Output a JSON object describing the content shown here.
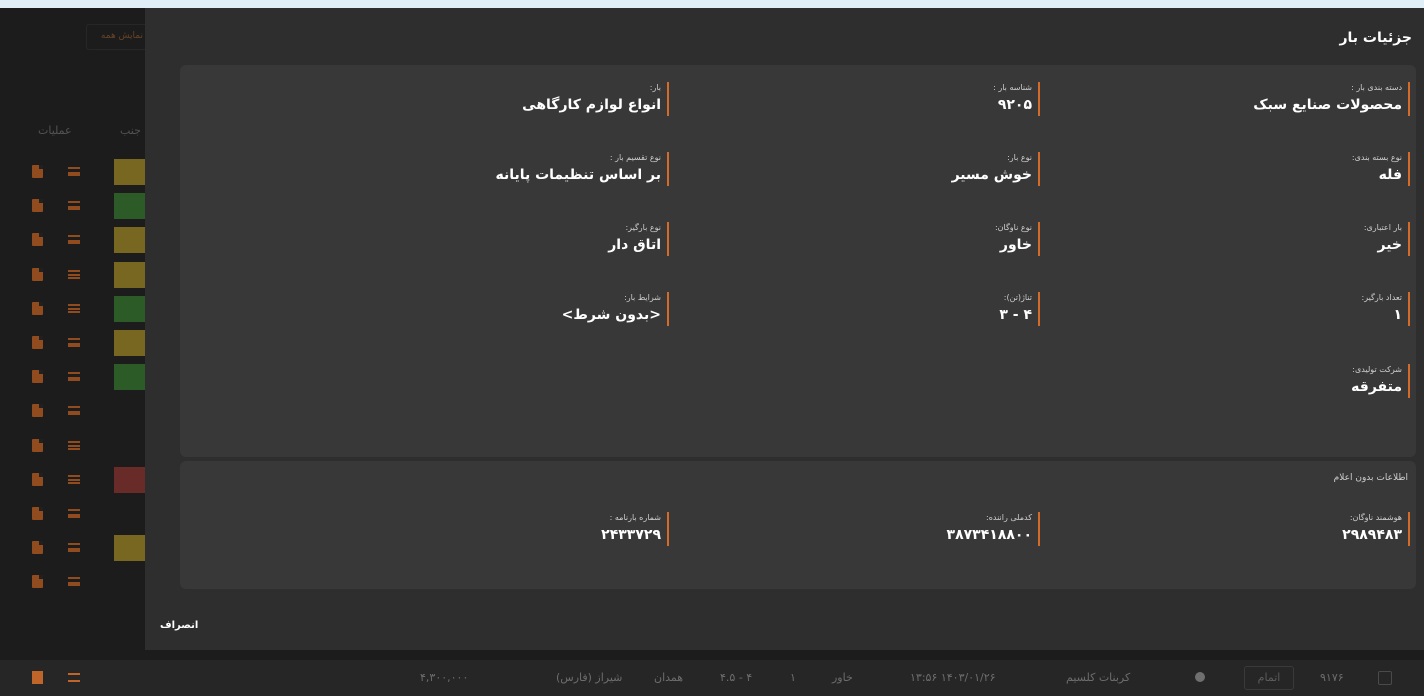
{
  "background": {
    "show_all": "نمایش همه",
    "header": {
      "operations": "عملیات",
      "col2": "جنب"
    },
    "rows": [
      {
        "status_color": "#a08a2c"
      },
      {
        "status_color": "#3c7a36"
      },
      {
        "status_color": "#a08a2c"
      },
      {
        "status_color": "#a08a2c"
      },
      {
        "status_color": "#3c7a36"
      },
      {
        "status_color": "#a08a2c"
      },
      {
        "status_color": "#3c7a36"
      },
      {
        "status_color": ""
      },
      {
        "status_color": ""
      },
      {
        "status_color": "#8c3a34"
      },
      {
        "status_color": ""
      },
      {
        "status_color": "#a08a2c"
      },
      {
        "status_color": ""
      }
    ],
    "bottom_row": {
      "id": "۹۱۷۶",
      "done_button": "اتمام",
      "product": "کربنات کلسیم",
      "datetime": "۱۴۰۳/۰۱/۲۶ ۱۳:۵۶",
      "vehicle": "خاور",
      "count": "۱",
      "tonnage": "۴ - ۴.۵",
      "destination": "همدان",
      "origin": "شیراز (فارس)",
      "price": "۴,۳۰۰,۰۰۰"
    }
  },
  "modal": {
    "title": "جزئیات بار",
    "fields": {
      "category_label": "دسته بندی بار :",
      "category_value": "محصولات صنایع سبک",
      "cargo_id_label": "شناسه بار :",
      "cargo_id_value": "۹۲۰۵",
      "cargo_label": "بار:",
      "cargo_value": "انواع لوازم کارگاهی",
      "packaging_label": "نوع بسته بندی:",
      "packaging_value": "فله",
      "cargo_type_label": "نوع بار:",
      "cargo_type_value": "خوش مسیر",
      "split_type_label": "نوع تقسیم بار :",
      "split_type_value": "بر اساس تنظیمات پایانه",
      "credit_label": "بار اعتباری:",
      "credit_value": "خیر",
      "fleet_type_label": "نوع ناوگان:",
      "fleet_type_value": "خاور",
      "loader_type_label": "نوع بارگیر:",
      "loader_type_value": "اتاق دار",
      "loader_count_label": "تعداد بارگیر:",
      "loader_count_value": "۱",
      "tonnage_label": "تناژ(تن):",
      "tonnage_value": "۴ - ۳",
      "conditions_label": "شرایط بار:",
      "conditions_value": "<بدون شرط>",
      "manufacturer_label": "شرکت تولیدی:",
      "manufacturer_value": "متفرقه"
    },
    "unannounced": {
      "title": "اطلاعات بدون اعلام",
      "smart_fleet_label": "هوشمند ناوگان:",
      "smart_fleet_value": "۲۹۸۹۴۸۳",
      "driver_id_label": "کدملی راننده:",
      "driver_id_value": "۳۸۷۳۴۱۸۸۰۰",
      "waybill_label": "شماره بارنامه :",
      "waybill_value": "۲۴۳۳۷۲۹"
    },
    "cancel_label": "انصراف"
  },
  "colors": {
    "accent": "#d36b2a",
    "modal_bg": "#2e2e2e",
    "card_bg": "#383838"
  }
}
